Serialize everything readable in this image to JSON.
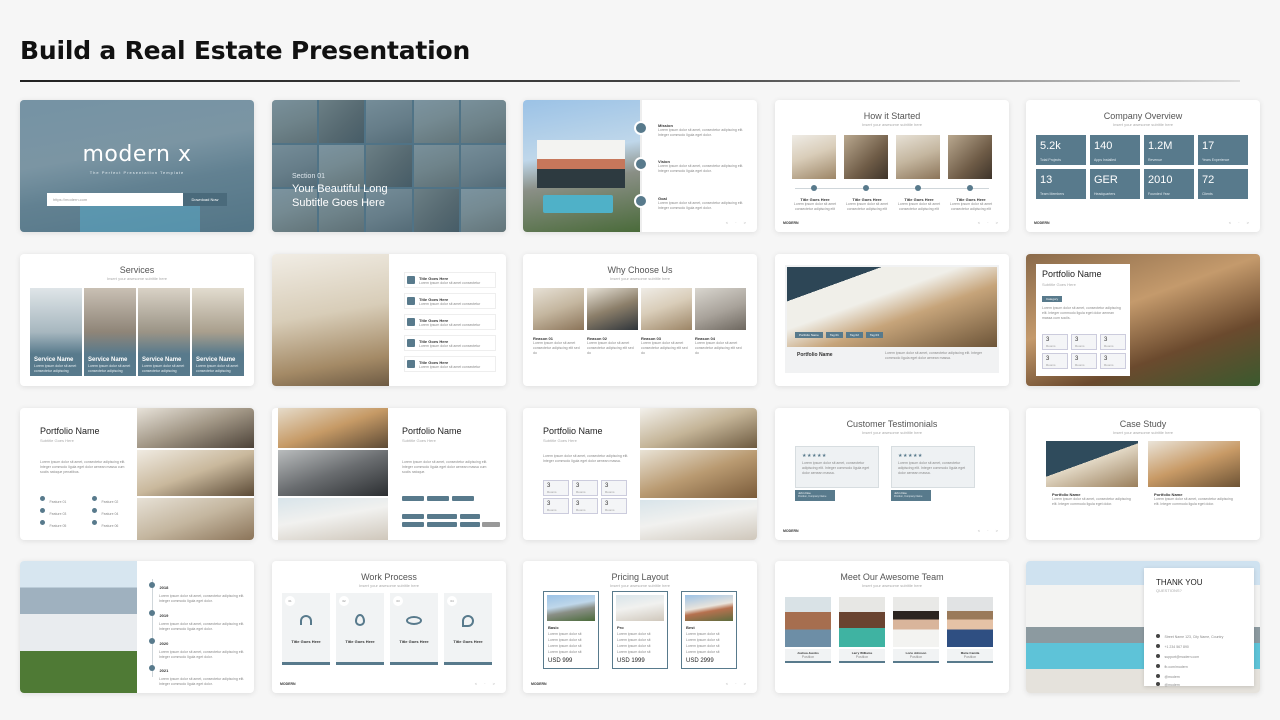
{
  "page": {
    "title": "Build a Real Estate Presentation"
  },
  "slides": {
    "cover": {
      "brand": "modern x",
      "tagline": "The Perfect Presentation Template",
      "search_placeholder": "https://modern.com",
      "button": "Download Now"
    },
    "section": {
      "label": "Section 01",
      "subtitle_line1": "Your Beautiful Long",
      "subtitle_line2": "Subtitle Goes Here"
    },
    "mission": {
      "items": [
        {
          "title": "Mission",
          "text": "Lorem ipsum dolor sit amet, consectetur adipiscing elit. Integer commodo ligula eget dolor."
        },
        {
          "title": "Vision",
          "text": "Lorem ipsum dolor sit amet, consectetur adipiscing elit. Integer commodo ligula eget dolor."
        },
        {
          "title": "Goal",
          "text": "Lorem ipsum dolor sit amet, consectetur adipiscing elit. Integer commodo ligula eget dolor."
        }
      ],
      "pager": "< · >"
    },
    "how_started": {
      "title": "How it Started",
      "subtitle": "Insert your awesome subtitle here",
      "steps": [
        {
          "title": "Title Goes Here",
          "text": "Lorem ipsum dolor sit amet consectetur adipiscing elit"
        },
        {
          "title": "Title Goes Here",
          "text": "Lorem ipsum dolor sit amet consectetur adipiscing elit"
        },
        {
          "title": "Title Goes Here",
          "text": "Lorem ipsum dolor sit amet consectetur adipiscing elit"
        },
        {
          "title": "Title Goes Here",
          "text": "Lorem ipsum dolor sit amet consectetur adipiscing elit"
        }
      ],
      "footer": "MODERN",
      "pager": "< · >"
    },
    "company": {
      "title": "Company Overview",
      "subtitle": "Insert your awesome subtitle here",
      "stats": [
        {
          "value": "5.2k",
          "label": "Total Projects"
        },
        {
          "value": "140",
          "label": "Apps Installed"
        },
        {
          "value": "1.2M",
          "label": "Revenue"
        },
        {
          "value": "17",
          "label": "Years Experience"
        },
        {
          "value": "13",
          "label": "Team Members"
        },
        {
          "value": "GER",
          "label": "Headquarters"
        },
        {
          "value": "2010",
          "label": "Founded Year"
        },
        {
          "value": "72",
          "label": "Clients"
        }
      ],
      "footer": "MODERN",
      "pager": "< · >"
    },
    "services": {
      "title": "Services",
      "subtitle": "Insert your awesome subtitle here",
      "items": [
        {
          "name": "Service Name",
          "text": "Lorem ipsum dolor sit amet consectetur adipiscing"
        },
        {
          "name": "Service Name",
          "text": "Lorem ipsum dolor sit amet consectetur adipiscing"
        },
        {
          "name": "Service Name",
          "text": "Lorem ipsum dolor sit amet consectetur adipiscing"
        },
        {
          "name": "Service Name",
          "text": "Lorem ipsum dolor sit amet consectetur adipiscing"
        }
      ]
    },
    "features": {
      "items": [
        {
          "title": "Title Goes Here",
          "text": "Lorem ipsum dolor sit amet consectetur"
        },
        {
          "title": "Title Goes Here",
          "text": "Lorem ipsum dolor sit amet consectetur"
        },
        {
          "title": "Title Goes Here",
          "text": "Lorem ipsum dolor sit amet consectetur"
        },
        {
          "title": "Title Goes Here",
          "text": "Lorem ipsum dolor sit amet consectetur"
        },
        {
          "title": "Title Goes Here",
          "text": "Lorem ipsum dolor sit amet consectetur"
        }
      ]
    },
    "why": {
      "title": "Why Choose Us",
      "subtitle": "Insert your awesome subtitle here",
      "reasons": [
        {
          "title": "Reason 01",
          "text": "Lorem ipsum dolor sit amet consectetur adipiscing elit sed do"
        },
        {
          "title": "Reason 02",
          "text": "Lorem ipsum dolor sit amet consectetur adipiscing elit sed do"
        },
        {
          "title": "Reason 03",
          "text": "Lorem ipsum dolor sit amet consectetur adipiscing elit sed do"
        },
        {
          "title": "Reason 04",
          "text": "Lorem ipsum dolor sit amet consectetur adipiscing elit sed do"
        }
      ]
    },
    "portfolio_wide": {
      "tabs": [
        "Portfolio Name",
        "Tag 01",
        "Tag 02",
        "Tag 03"
      ],
      "name": "Portfolio Name",
      "text": "Lorem ipsum dolor sit amet, consectetur adipiscing elit. Integer commodo ligula eget dolor aenean massa."
    },
    "portfolio_card": {
      "name": "Portfolio Name",
      "subtitle": "Subtitle Goes Here",
      "tag": "Category",
      "text": "Lorem ipsum dolor sit amet, consectetur adipiscing elit. Integer commodo ligula eget dolor aenean massa cum sociis.",
      "boxes": [
        {
          "value": "3",
          "label": "Rooms"
        },
        {
          "value": "3",
          "label": "Rooms"
        },
        {
          "value": "3",
          "label": "Rooms"
        },
        {
          "value": "3",
          "label": "Rooms"
        },
        {
          "value": "3",
          "label": "Rooms"
        },
        {
          "value": "3",
          "label": "Rooms"
        }
      ]
    },
    "portfolio_features": {
      "name": "Portfolio Name",
      "subtitle": "Subtitle Goes Here",
      "text": "Lorem ipsum dolor sit amet, consectetur adipiscing elit. Integer commodo ligula eget dolor aenean massa cum sociis natoque penatibus.",
      "features": [
        "Feature 01",
        "Feature 02",
        "Feature 03",
        "Feature 04",
        "Feature 05",
        "Feature 06"
      ]
    },
    "portfolio_tags": {
      "name": "Portfolio Name",
      "subtitle": "Subtitle Goes Here",
      "text": "Lorem ipsum dolor sit amet, consectetur adipiscing elit. Integer commodo ligula eget dolor aenean massa cum sociis natoque."
    },
    "portfolio_boxes": {
      "name": "Portfolio Name",
      "subtitle": "Subtitle Goes Here",
      "text": "Lorem ipsum dolor sit amet, consectetur adipiscing elit. Integer commodo ligula eget dolor aenean massa.",
      "boxes": [
        {
          "value": "3",
          "label": "Rooms"
        },
        {
          "value": "3",
          "label": "Rooms"
        },
        {
          "value": "3",
          "label": "Rooms"
        },
        {
          "value": "3",
          "label": "Rooms"
        },
        {
          "value": "3",
          "label": "Rooms"
        },
        {
          "value": "3",
          "label": "Rooms"
        }
      ]
    },
    "testimonials": {
      "title": "Customer Testimonials",
      "subtitle": "Insert your awesome subtitle here",
      "stars": "★★★★★",
      "items": [
        {
          "text": "Lorem ipsum dolor sit amet, consectetur adipiscing elit. Integer commodo ligula eget dolor aenean massa.",
          "name": "John Doe",
          "role": "Position, Company Name"
        },
        {
          "text": "Lorem ipsum dolor sit amet, consectetur adipiscing elit. Integer commodo ligula eget dolor aenean massa.",
          "name": "John Doe",
          "role": "Position, Company Name"
        }
      ],
      "footer": "MODERN",
      "pager": "< · >"
    },
    "case_study": {
      "title": "Case Study",
      "subtitle": "Insert your awesome subtitle here",
      "items": [
        {
          "name": "Portfolio Name",
          "text": "Lorem ipsum dolor sit amet, consectetur adipiscing elit. Integer commodo ligula eget dolor."
        },
        {
          "name": "Portfolio Name",
          "text": "Lorem ipsum dolor sit amet, consectetur adipiscing elit. Integer commodo ligula eget dolor."
        }
      ]
    },
    "timeline": {
      "years": [
        {
          "year": "2018",
          "text": "Lorem ipsum dolor sit amet, consectetur adipiscing elit. Integer commodo ligula eget dolor."
        },
        {
          "year": "2019",
          "text": "Lorem ipsum dolor sit amet, consectetur adipiscing elit. Integer commodo ligula eget dolor."
        },
        {
          "year": "2020",
          "text": "Lorem ipsum dolor sit amet, consectetur adipiscing elit. Integer commodo ligula eget dolor."
        },
        {
          "year": "2021",
          "text": "Lorem ipsum dolor sit amet, consectetur adipiscing elit. Integer commodo ligula eget dolor."
        }
      ]
    },
    "work_process": {
      "title": "Work Process",
      "subtitle": "Insert your awesome subtitle here",
      "steps": [
        {
          "num": "01",
          "title": "Title Goes Here",
          "icon": "headphones-icon"
        },
        {
          "num": "02",
          "title": "Title Goes Here",
          "icon": "flame-icon"
        },
        {
          "num": "03",
          "title": "Title Goes Here",
          "icon": "eye-icon"
        },
        {
          "num": "04",
          "title": "Title Goes Here",
          "icon": "guitar-icon"
        }
      ],
      "footer": "MODERN",
      "pager": "< · >"
    },
    "pricing": {
      "title": "Pricing Layout",
      "subtitle": "Insert your awesome subtitle here",
      "plans": [
        {
          "name": "Basic",
          "price": "USD 999"
        },
        {
          "name": "Pro",
          "price": "USD 1999"
        },
        {
          "name": "Best",
          "price": "USD 2999"
        }
      ],
      "feature_text": "Lorem ipsum dolor sit",
      "footer": "MODERN",
      "pager": "< · >"
    },
    "team": {
      "title": "Meet Our Awesome Team",
      "subtitle": "Insert your awesome subtitle here",
      "members": [
        {
          "name": "Joshua Jacobs",
          "role": "Position"
        },
        {
          "name": "Larry Williams",
          "role": "Position"
        },
        {
          "name": "Lorie Johnson",
          "role": "Position"
        },
        {
          "name": "Marie Camila",
          "role": "Position"
        }
      ]
    },
    "thanks": {
      "title": "THANK YOU",
      "subtitle": "QUESTIONS?",
      "contacts": [
        "Street Name 123, City Name, Country",
        "+1 234 567 890",
        "support@modern.com",
        "fb.com/modern",
        "@modern",
        "@modern"
      ]
    }
  },
  "colors": {
    "accent": "#587a8c",
    "accent_dark": "#4a6a7b"
  }
}
